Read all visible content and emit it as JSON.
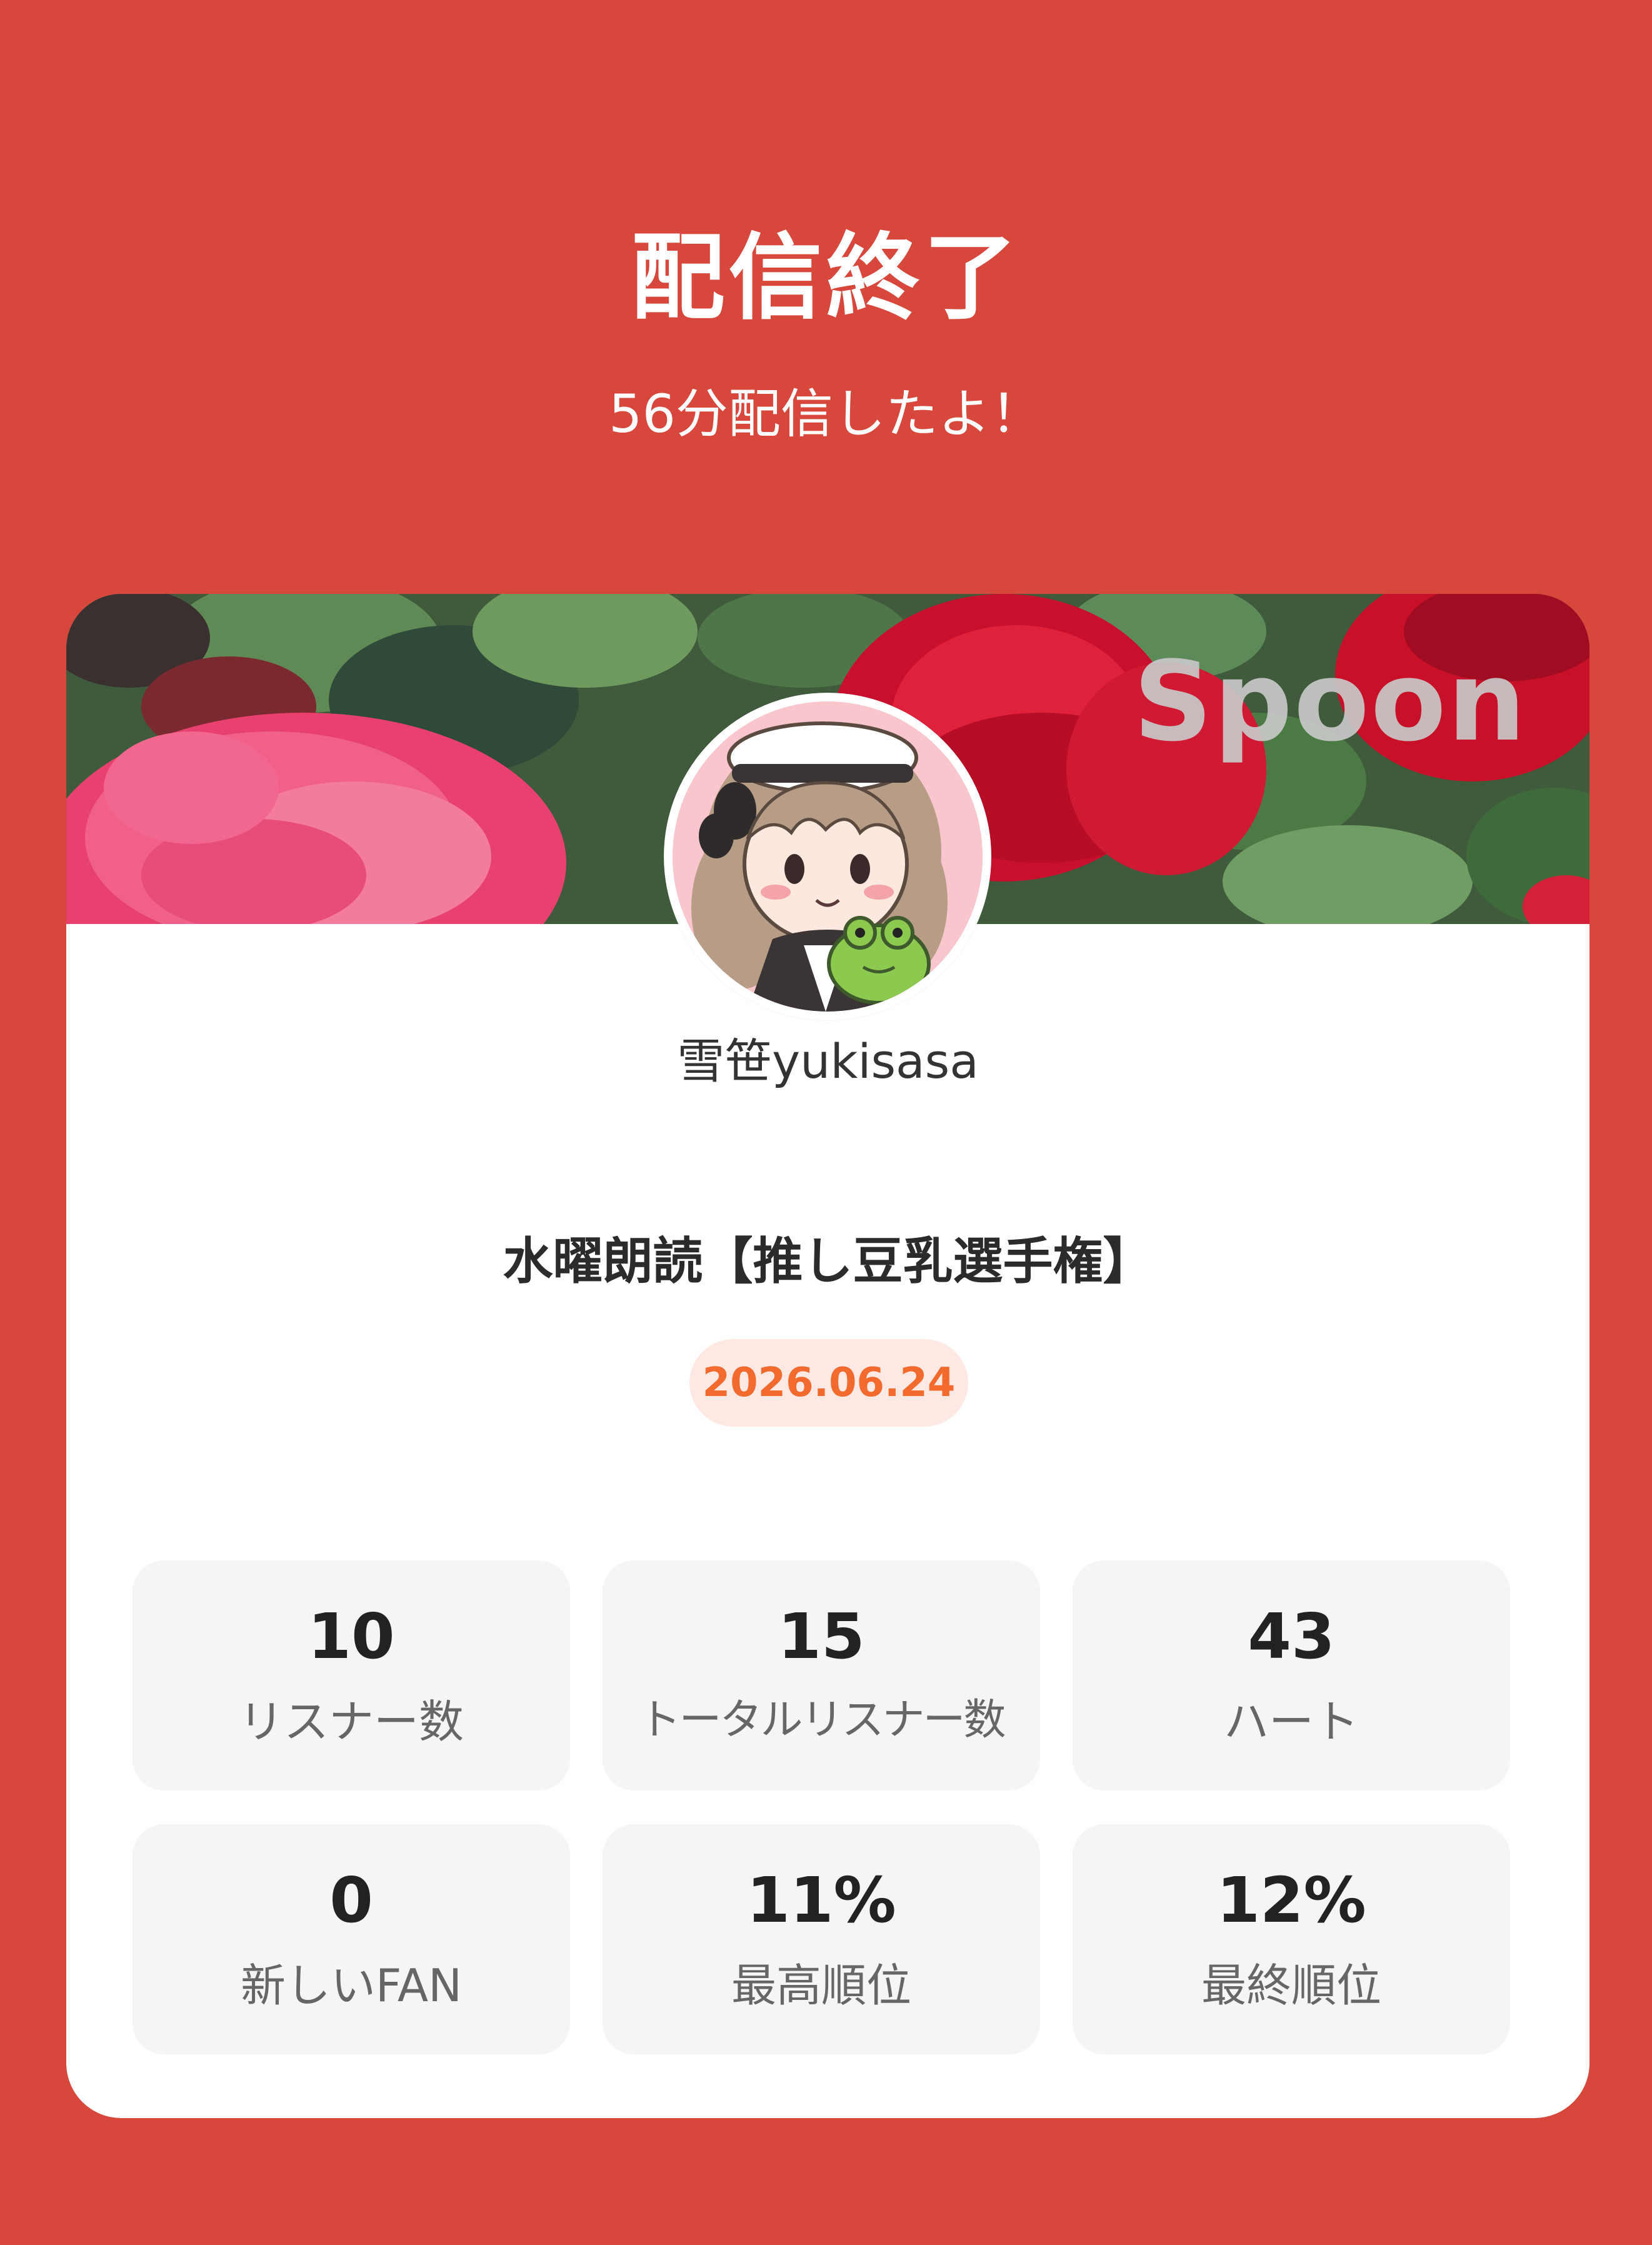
{
  "header": {
    "title": "配信終了",
    "subtitle": "56分配信したよ！"
  },
  "card": {
    "brand": "Spoon",
    "username": "雪笹yukisasa",
    "live_title": "水曜朗読【推し豆乳選手権】",
    "date": "2026.06.24"
  },
  "stats": [
    {
      "value": "10",
      "label": "リスナー数"
    },
    {
      "value": "15",
      "label": "トータルリスナー数"
    },
    {
      "value": "43",
      "label": "ハート"
    },
    {
      "value": "0",
      "label": "新しいFAN"
    },
    {
      "value": "11%",
      "label": "最高順位"
    },
    {
      "value": "12%",
      "label": "最終順位"
    }
  ],
  "colors": {
    "background": "#D8473B",
    "card": "#FFFFFF",
    "date_text": "#F26A2E",
    "date_bg": "#FDE8E3",
    "stat_bg": "#F5F5F5"
  },
  "icons": {
    "banner": "rose-banner-image",
    "avatar": "avatar-illustration"
  }
}
